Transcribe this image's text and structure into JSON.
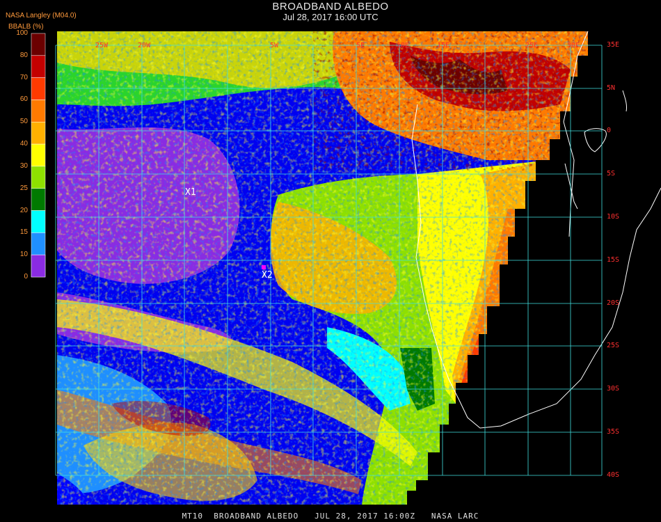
{
  "header": {
    "title": "BROADBAND ALBEDO",
    "subtitle": "Jul 28, 2017 16:00 UTC",
    "provider": "NASA Langley (M04.0)",
    "units": "BBALB (%)"
  },
  "footer": "MT10  BROADBAND ALBEDO   JUL 28, 2017 16:00Z   NASA LARC",
  "colorbar": {
    "ticks": [
      "100",
      "80",
      "70",
      "60",
      "50",
      "40",
      "30",
      "25",
      "20",
      "15",
      "10",
      "0"
    ],
    "colors": [
      "#6b0000",
      "#c30000",
      "#ff3a00",
      "#ff7a00",
      "#ffb000",
      "#ffff00",
      "#8ee000",
      "#007a00",
      "#00ffff",
      "#1f8fff",
      "#0000ff",
      "#8a2be2"
    ]
  },
  "grid": {
    "lat_labels": [
      "35E",
      "5N",
      "0",
      "5S",
      "10S",
      "15S",
      "20S",
      "25S",
      "30S",
      "35S",
      "40S"
    ],
    "lon_labels": [
      "25W",
      "20W",
      "5W",
      "5E",
      "10E",
      "15E",
      "25E",
      "30E"
    ]
  },
  "markers": [
    {
      "label": "X1"
    },
    {
      "label": "X2"
    }
  ]
}
